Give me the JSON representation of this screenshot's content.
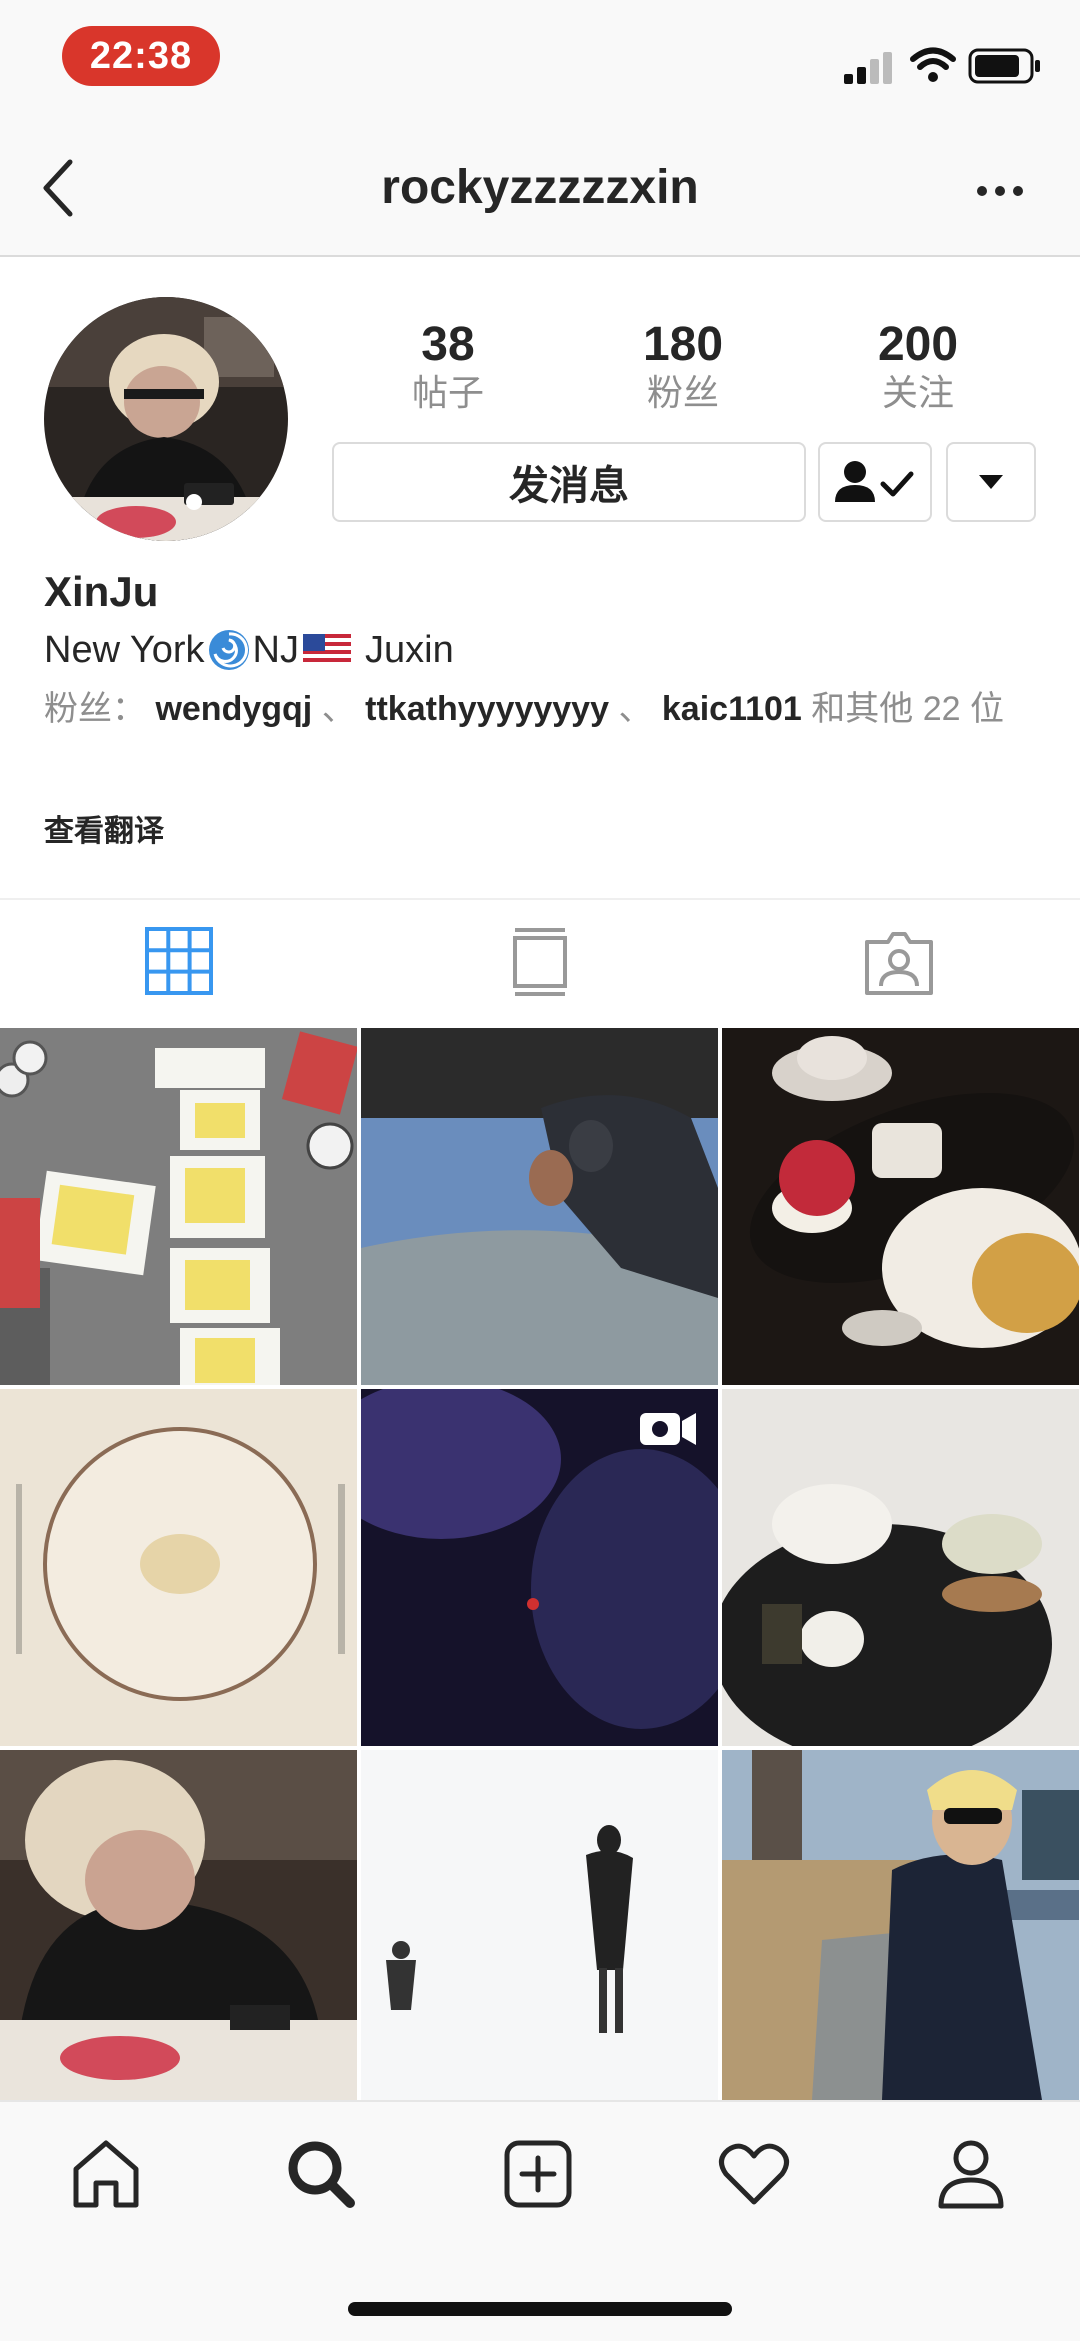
{
  "status_bar": {
    "time": "22:38"
  },
  "header": {
    "username": "rockyzzzzzxin"
  },
  "profile": {
    "stats": [
      {
        "count": "38",
        "label": "帖子"
      },
      {
        "count": "180",
        "label": "粉丝"
      },
      {
        "count": "200",
        "label": "关注"
      }
    ],
    "message_button": "发消息",
    "name": "XinJu",
    "bio": {
      "part1": "New York",
      "part2": "NJ",
      "part3": "Juxin"
    },
    "followed_by": {
      "prefix": "粉丝：",
      "users": [
        "wendygqj",
        "ttkathyyyyyyyy",
        "kaic1101"
      ],
      "separator": "、",
      "suffix": "和其他 22 位"
    },
    "see_translation": "查看翻译"
  },
  "tabs": [
    {
      "icon": "grid-icon",
      "active": true
    },
    {
      "icon": "feed-list-icon",
      "active": false
    },
    {
      "icon": "tagged-icon",
      "active": false
    }
  ],
  "posts": [
    {
      "name": "post-playing-cards"
    },
    {
      "name": "post-skydiving"
    },
    {
      "name": "post-dessert-plate"
    },
    {
      "name": "post-empty-plate"
    },
    {
      "name": "post-night-video",
      "video": true
    },
    {
      "name": "post-tea-dessert"
    },
    {
      "name": "post-dining-portrait"
    },
    {
      "name": "post-silhouettes"
    },
    {
      "name": "post-park-bench"
    }
  ],
  "bottom_nav": [
    "home-icon",
    "search-icon",
    "add-post-icon",
    "activity-heart-icon",
    "profile-icon"
  ],
  "colors": {
    "accent_blue": "#3897f0",
    "status_red": "#d9362b",
    "secondary_text": "#8e8e8e"
  }
}
